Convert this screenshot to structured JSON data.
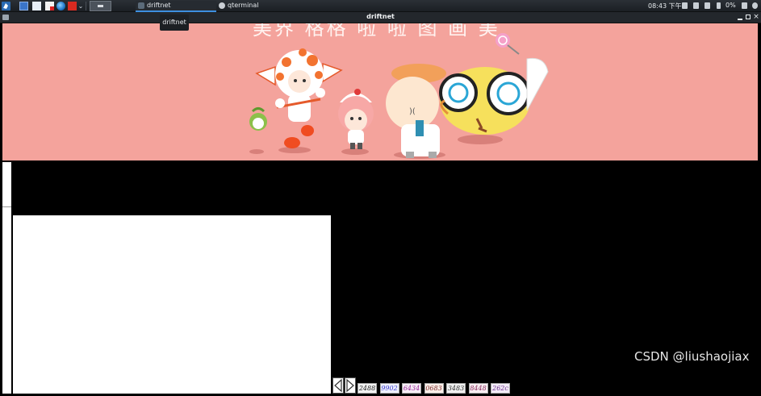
{
  "taskbar": {
    "tasks": [
      {
        "label": "driftnet",
        "active": true
      },
      {
        "label": "qterminal",
        "active": false
      }
    ],
    "clock": "08:43 下午",
    "battery": "0%"
  },
  "tooltip": "driftnet",
  "window": {
    "title": "driftnet"
  },
  "banner": {
    "partial_text": "美界 格格 啦 啦 图 画 美"
  },
  "captcha_images": [
    {
      "text": "2488",
      "color": "#222222",
      "bg": "#f2f2f2"
    },
    {
      "text": "9902",
      "color": "#3b3bc8",
      "bg": "#eef0ff"
    },
    {
      "text": "6434",
      "color": "#9a2b9a",
      "bg": "#f7eef7"
    },
    {
      "text": "0683",
      "color": "#7a2b2b",
      "bg": "#fbefe9"
    },
    {
      "text": "3483",
      "color": "#333333",
      "bg": "#f0f0f0"
    },
    {
      "text": "8448",
      "color": "#8a3060",
      "bg": "#f8edf2"
    },
    {
      "text": "262c",
      "color": "#6a2c8a",
      "bg": "#f3ecf8"
    }
  ],
  "watermark": "CSDN @liushaojiax",
  "colors": {
    "banner_bg": "#f4a39c",
    "taskbar_bg": "#1f2328",
    "accent": "#3d8fe0"
  },
  "icons": [
    "menu-icon",
    "workspace-icon",
    "file-manager-icon",
    "text-editor-icon",
    "browser-icon",
    "flag-icon",
    "chevron-down-icon",
    "terminal-icon",
    "screen-icon",
    "volume-icon",
    "notification-icon",
    "battery-icon",
    "lock-icon",
    "power-icon"
  ]
}
